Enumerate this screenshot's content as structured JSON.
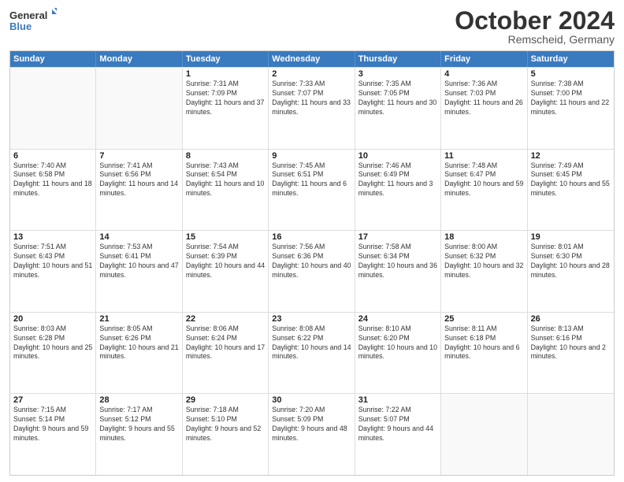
{
  "header": {
    "logo_line1": "General",
    "logo_line2": "Blue",
    "month": "October 2024",
    "location": "Remscheid, Germany"
  },
  "weekdays": [
    "Sunday",
    "Monday",
    "Tuesday",
    "Wednesday",
    "Thursday",
    "Friday",
    "Saturday"
  ],
  "rows": [
    [
      {
        "day": "",
        "text": ""
      },
      {
        "day": "",
        "text": ""
      },
      {
        "day": "1",
        "text": "Sunrise: 7:31 AM\nSunset: 7:09 PM\nDaylight: 11 hours and 37 minutes."
      },
      {
        "day": "2",
        "text": "Sunrise: 7:33 AM\nSunset: 7:07 PM\nDaylight: 11 hours and 33 minutes."
      },
      {
        "day": "3",
        "text": "Sunrise: 7:35 AM\nSunset: 7:05 PM\nDaylight: 11 hours and 30 minutes."
      },
      {
        "day": "4",
        "text": "Sunrise: 7:36 AM\nSunset: 7:03 PM\nDaylight: 11 hours and 26 minutes."
      },
      {
        "day": "5",
        "text": "Sunrise: 7:38 AM\nSunset: 7:00 PM\nDaylight: 11 hours and 22 minutes."
      }
    ],
    [
      {
        "day": "6",
        "text": "Sunrise: 7:40 AM\nSunset: 6:58 PM\nDaylight: 11 hours and 18 minutes."
      },
      {
        "day": "7",
        "text": "Sunrise: 7:41 AM\nSunset: 6:56 PM\nDaylight: 11 hours and 14 minutes."
      },
      {
        "day": "8",
        "text": "Sunrise: 7:43 AM\nSunset: 6:54 PM\nDaylight: 11 hours and 10 minutes."
      },
      {
        "day": "9",
        "text": "Sunrise: 7:45 AM\nSunset: 6:51 PM\nDaylight: 11 hours and 6 minutes."
      },
      {
        "day": "10",
        "text": "Sunrise: 7:46 AM\nSunset: 6:49 PM\nDaylight: 11 hours and 3 minutes."
      },
      {
        "day": "11",
        "text": "Sunrise: 7:48 AM\nSunset: 6:47 PM\nDaylight: 10 hours and 59 minutes."
      },
      {
        "day": "12",
        "text": "Sunrise: 7:49 AM\nSunset: 6:45 PM\nDaylight: 10 hours and 55 minutes."
      }
    ],
    [
      {
        "day": "13",
        "text": "Sunrise: 7:51 AM\nSunset: 6:43 PM\nDaylight: 10 hours and 51 minutes."
      },
      {
        "day": "14",
        "text": "Sunrise: 7:53 AM\nSunset: 6:41 PM\nDaylight: 10 hours and 47 minutes."
      },
      {
        "day": "15",
        "text": "Sunrise: 7:54 AM\nSunset: 6:39 PM\nDaylight: 10 hours and 44 minutes."
      },
      {
        "day": "16",
        "text": "Sunrise: 7:56 AM\nSunset: 6:36 PM\nDaylight: 10 hours and 40 minutes."
      },
      {
        "day": "17",
        "text": "Sunrise: 7:58 AM\nSunset: 6:34 PM\nDaylight: 10 hours and 36 minutes."
      },
      {
        "day": "18",
        "text": "Sunrise: 8:00 AM\nSunset: 6:32 PM\nDaylight: 10 hours and 32 minutes."
      },
      {
        "day": "19",
        "text": "Sunrise: 8:01 AM\nSunset: 6:30 PM\nDaylight: 10 hours and 28 minutes."
      }
    ],
    [
      {
        "day": "20",
        "text": "Sunrise: 8:03 AM\nSunset: 6:28 PM\nDaylight: 10 hours and 25 minutes."
      },
      {
        "day": "21",
        "text": "Sunrise: 8:05 AM\nSunset: 6:26 PM\nDaylight: 10 hours and 21 minutes."
      },
      {
        "day": "22",
        "text": "Sunrise: 8:06 AM\nSunset: 6:24 PM\nDaylight: 10 hours and 17 minutes."
      },
      {
        "day": "23",
        "text": "Sunrise: 8:08 AM\nSunset: 6:22 PM\nDaylight: 10 hours and 14 minutes."
      },
      {
        "day": "24",
        "text": "Sunrise: 8:10 AM\nSunset: 6:20 PM\nDaylight: 10 hours and 10 minutes."
      },
      {
        "day": "25",
        "text": "Sunrise: 8:11 AM\nSunset: 6:18 PM\nDaylight: 10 hours and 6 minutes."
      },
      {
        "day": "26",
        "text": "Sunrise: 8:13 AM\nSunset: 6:16 PM\nDaylight: 10 hours and 2 minutes."
      }
    ],
    [
      {
        "day": "27",
        "text": "Sunrise: 7:15 AM\nSunset: 5:14 PM\nDaylight: 9 hours and 59 minutes."
      },
      {
        "day": "28",
        "text": "Sunrise: 7:17 AM\nSunset: 5:12 PM\nDaylight: 9 hours and 55 minutes."
      },
      {
        "day": "29",
        "text": "Sunrise: 7:18 AM\nSunset: 5:10 PM\nDaylight: 9 hours and 52 minutes."
      },
      {
        "day": "30",
        "text": "Sunrise: 7:20 AM\nSunset: 5:09 PM\nDaylight: 9 hours and 48 minutes."
      },
      {
        "day": "31",
        "text": "Sunrise: 7:22 AM\nSunset: 5:07 PM\nDaylight: 9 hours and 44 minutes."
      },
      {
        "day": "",
        "text": ""
      },
      {
        "day": "",
        "text": ""
      }
    ]
  ]
}
